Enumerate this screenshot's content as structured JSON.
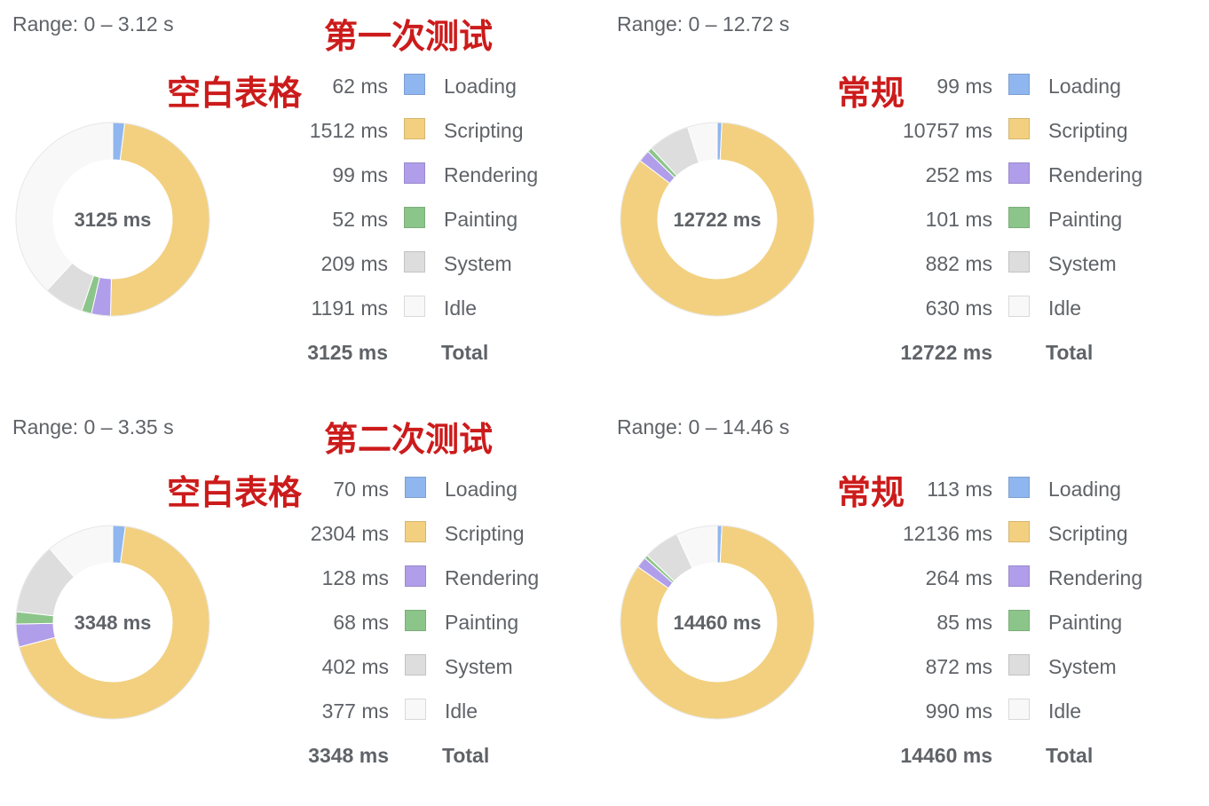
{
  "chart_data": [
    {
      "type": "pie",
      "range": "Range: 0 – 3.12 s",
      "test_title": "第一次测试",
      "variant_title": "空白表格",
      "center_label": "3125 ms",
      "categories": [
        "Loading",
        "Scripting",
        "Rendering",
        "Painting",
        "System",
        "Idle"
      ],
      "value_labels": [
        "62 ms",
        "1512 ms",
        "99 ms",
        "52 ms",
        "209 ms",
        "1191 ms"
      ],
      "values": [
        62,
        1512,
        99,
        52,
        209,
        1191
      ],
      "total_value_label": "3125 ms",
      "total_label": "Total"
    },
    {
      "type": "pie",
      "range": "Range: 0 – 12.72 s",
      "test_title": "",
      "variant_title": "常规",
      "center_label": "12722 ms",
      "categories": [
        "Loading",
        "Scripting",
        "Rendering",
        "Painting",
        "System",
        "Idle"
      ],
      "value_labels": [
        "99 ms",
        "10757 ms",
        "252 ms",
        "101 ms",
        "882 ms",
        "630 ms"
      ],
      "values": [
        99,
        10757,
        252,
        101,
        882,
        630
      ],
      "total_value_label": "12722 ms",
      "total_label": "Total"
    },
    {
      "type": "pie",
      "range": "Range: 0 – 3.35 s",
      "test_title": "第二次测试",
      "variant_title": "空白表格",
      "center_label": "3348 ms",
      "categories": [
        "Loading",
        "Scripting",
        "Rendering",
        "Painting",
        "System",
        "Idle"
      ],
      "value_labels": [
        "70 ms",
        "2304 ms",
        "128 ms",
        "68 ms",
        "402 ms",
        "377 ms"
      ],
      "values": [
        70,
        2304,
        128,
        68,
        402,
        377
      ],
      "total_value_label": "3348 ms",
      "total_label": "Total"
    },
    {
      "type": "pie",
      "range": "Range: 0 – 14.46 s",
      "test_title": "",
      "variant_title": "常规",
      "center_label": "14460 ms",
      "categories": [
        "Loading",
        "Scripting",
        "Rendering",
        "Painting",
        "System",
        "Idle"
      ],
      "value_labels": [
        "113 ms",
        "12136 ms",
        "264 ms",
        "85 ms",
        "872 ms",
        "990 ms"
      ],
      "values": [
        113,
        12136,
        264,
        85,
        872,
        990
      ],
      "total_value_label": "14460 ms",
      "total_label": "Total"
    }
  ],
  "colors": {
    "Loading": "#8fb6ee",
    "Scripting": "#f2d07f",
    "Rendering": "#b09eea",
    "Painting": "#8cc58a",
    "System": "#dddddd",
    "Idle": "#f8f8f8",
    "annotation": "#cc1b1b"
  }
}
